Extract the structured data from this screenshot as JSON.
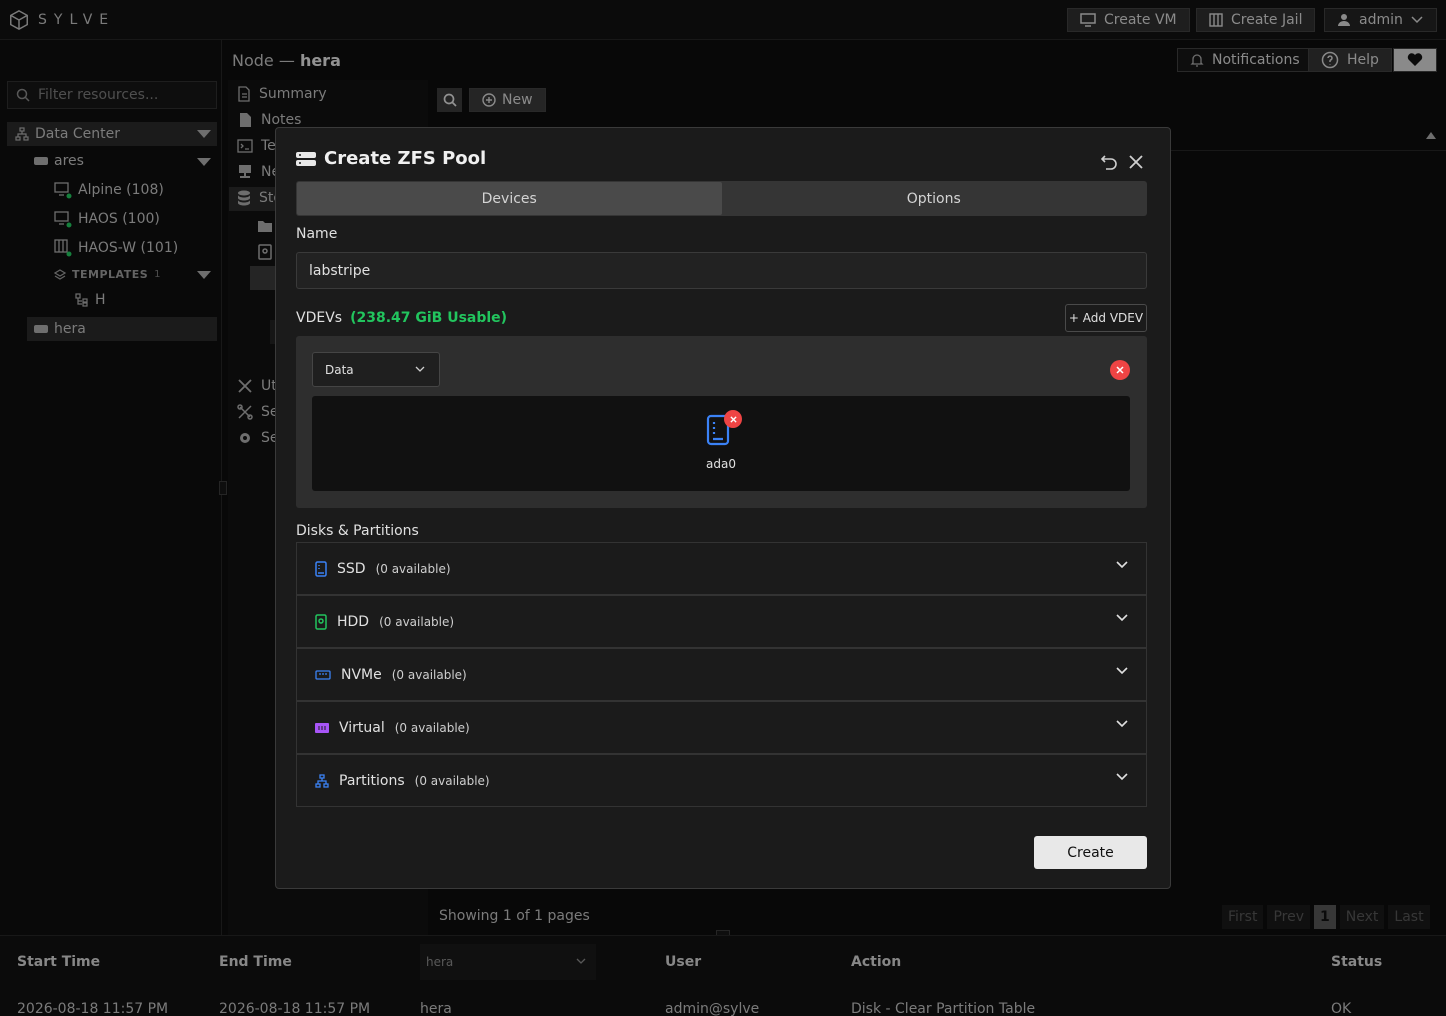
{
  "app": {
    "logo_text": "SYLVE"
  },
  "topbar": {
    "create_vm": "Create VM",
    "create_jail": "Create Jail",
    "user": "admin"
  },
  "header": {
    "node_prefix": "Node —",
    "node_name": "hera",
    "notifications": "Notifications",
    "help": "Help"
  },
  "sidebar": {
    "filter_placeholder": "Filter resources...",
    "datacenter": "Data Center",
    "nodes": [
      {
        "name": "ares",
        "children": [
          "Alpine (108)",
          "HAOS (100)",
          "HAOS-W (101)"
        ]
      },
      {
        "name": "hera"
      }
    ],
    "templates_label": "TEMPLATES",
    "templates_count": "1",
    "template_item": "H"
  },
  "submenu": {
    "items": [
      "Summary",
      "Notes",
      "Te",
      "Ne",
      "Sto",
      "Uti",
      "Ser",
      "Set"
    ]
  },
  "content": {
    "new_button": "New",
    "showing": "Showing 1 of 1 pages",
    "pager": [
      "First",
      "Prev",
      "1",
      "Next",
      "Last"
    ]
  },
  "modal": {
    "title": "Create ZFS Pool",
    "tabs": [
      "Devices",
      "Options"
    ],
    "name_label": "Name",
    "name_value": "labstripe",
    "vdevs_label": "VDEVs",
    "vdevs_usable": "(238.47 GiB Usable)",
    "add_vdev": "+ Add VDEV",
    "vdev_type": "Data",
    "vdev_device": "ada0",
    "disks_label": "Disks & Partitions",
    "disk_groups": [
      {
        "name": "SSD",
        "count": "(0 available)",
        "icon": "ssd-icon",
        "color": "#3b82f6"
      },
      {
        "name": "HDD",
        "count": "(0 available)",
        "icon": "hdd-icon",
        "color": "#22c55e"
      },
      {
        "name": "NVMe",
        "count": "(0 available)",
        "icon": "nvme-icon",
        "color": "#3b82f6"
      },
      {
        "name": "Virtual",
        "count": "(0 available)",
        "icon": "virtual-icon",
        "color": "#a855f7"
      },
      {
        "name": "Partitions",
        "count": "(0 available)",
        "icon": "partitions-icon",
        "color": "#3b82f6"
      }
    ],
    "create": "Create"
  },
  "tasks": {
    "headers": [
      "Start Time",
      "End Time",
      "User",
      "Action",
      "Status"
    ],
    "node_filter": "hera",
    "row": {
      "start": "2026-08-18 11:57 PM",
      "end": "2026-08-18 11:57 PM",
      "node": "hera",
      "user": "admin@sylve",
      "action": "Disk - Clear Partition Table",
      "status": "OK"
    }
  },
  "colors": {
    "accent_green": "#22c55e",
    "danger": "#ef4444",
    "device_blue": "#3b82f6"
  }
}
